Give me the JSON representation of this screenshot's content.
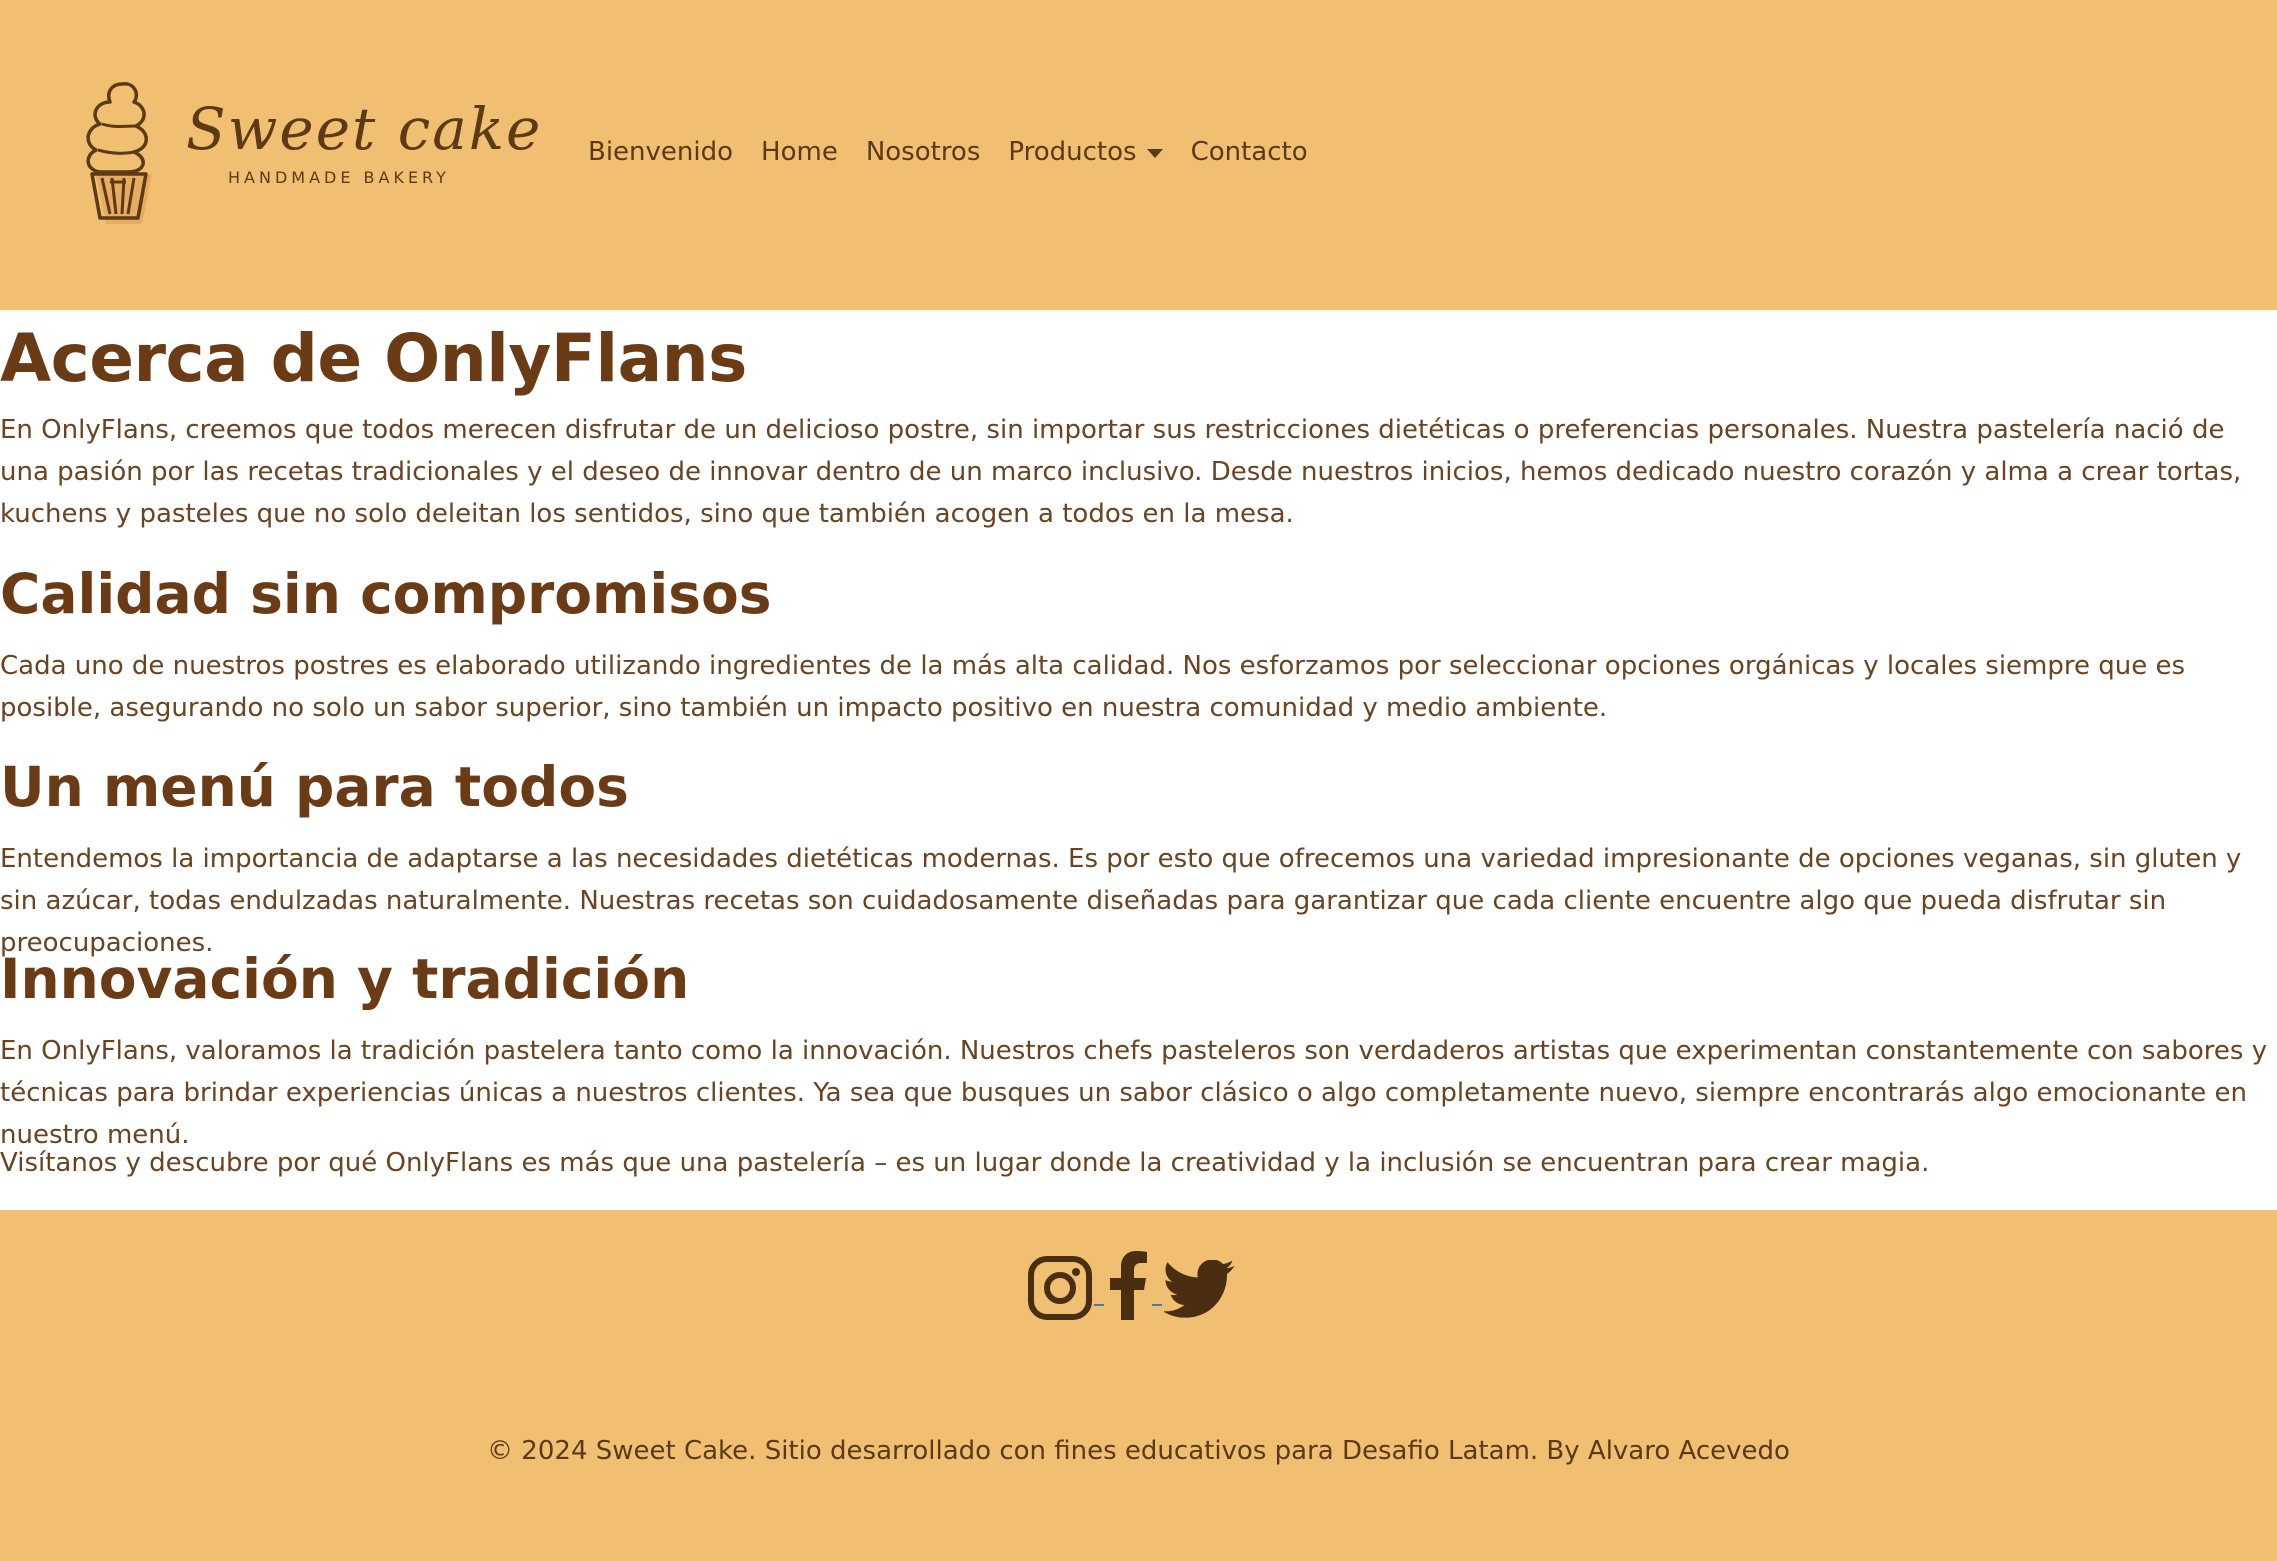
{
  "header": {
    "logo": {
      "script_text": "Sweet cake",
      "subtitle": "HANDMADE BAKERY"
    },
    "nav": {
      "items": [
        {
          "label": "Bienvenido"
        },
        {
          "label": "Home"
        },
        {
          "label": "Nosotros"
        },
        {
          "label": "Productos",
          "has_dropdown": true
        },
        {
          "label": "Contacto"
        }
      ]
    }
  },
  "main": {
    "title": "Acerca de OnlyFlans",
    "intro": "En OnlyFlans, creemos que todos merecen disfrutar de un delicioso postre, sin importar sus restricciones dietéticas o preferencias personales. Nuestra pastelería nació de una pasión por las recetas tradicionales y el deseo de innovar dentro de un marco inclusivo. Desde nuestros inicios, hemos dedicado nuestro corazón y alma a crear tortas, kuchens y pasteles que no solo deleitan los sentidos, sino que también acogen a todos en la mesa.",
    "sections": [
      {
        "heading": "Calidad sin compromisos",
        "text": "Cada uno de nuestros postres es elaborado utilizando ingredientes de la más alta calidad. Nos esforzamos por seleccionar opciones orgánicas y locales siempre que es posible, asegurando no solo un sabor superior, sino también un impacto positivo en nuestra comunidad y medio ambiente."
      },
      {
        "heading": "Un menú para todos",
        "text": "Entendemos la importancia de adaptarse a las necesidades dietéticas modernas. Es por esto que ofrecemos una variedad impresionante de opciones veganas, sin gluten y sin azúcar, todas endulzadas naturalmente. Nuestras recetas son cuidadosamente diseñadas para garantizar que cada cliente encuentre algo que pueda disfrutar sin preocupaciones."
      },
      {
        "heading": "Innovación y tradición",
        "text": "En OnlyFlans, valoramos la tradición pastelera tanto como la innovación. Nuestros chefs pasteleros son verdaderos artistas que experimentan constantemente con sabores y técnicas para brindar experiencias únicas a nuestros clientes. Ya sea que busques un sabor clásico o algo completamente nuevo, siempre encontrarás algo emocionante en nuestro menú."
      }
    ],
    "closing": "Visítanos y descubre por qué OnlyFlans es más que una pastelería – es un lugar donde la creatividad y la inclusión se encuentran para crear magia."
  },
  "footer": {
    "social": [
      {
        "icon": "instagram-icon"
      },
      {
        "icon": "facebook-icon"
      },
      {
        "icon": "twitter-icon"
      }
    ],
    "copyright": "© 2024 Sweet Cake. Sitio desarrollado con fines educativos para Desafio Latam. By Alvaro Acevedo"
  },
  "colors": {
    "header_bg": "#f0bf72",
    "footer_bg": "#f0bf72",
    "heading": "#6b3b16",
    "body_text": "#6b4321",
    "icon": "#4a2e12"
  }
}
